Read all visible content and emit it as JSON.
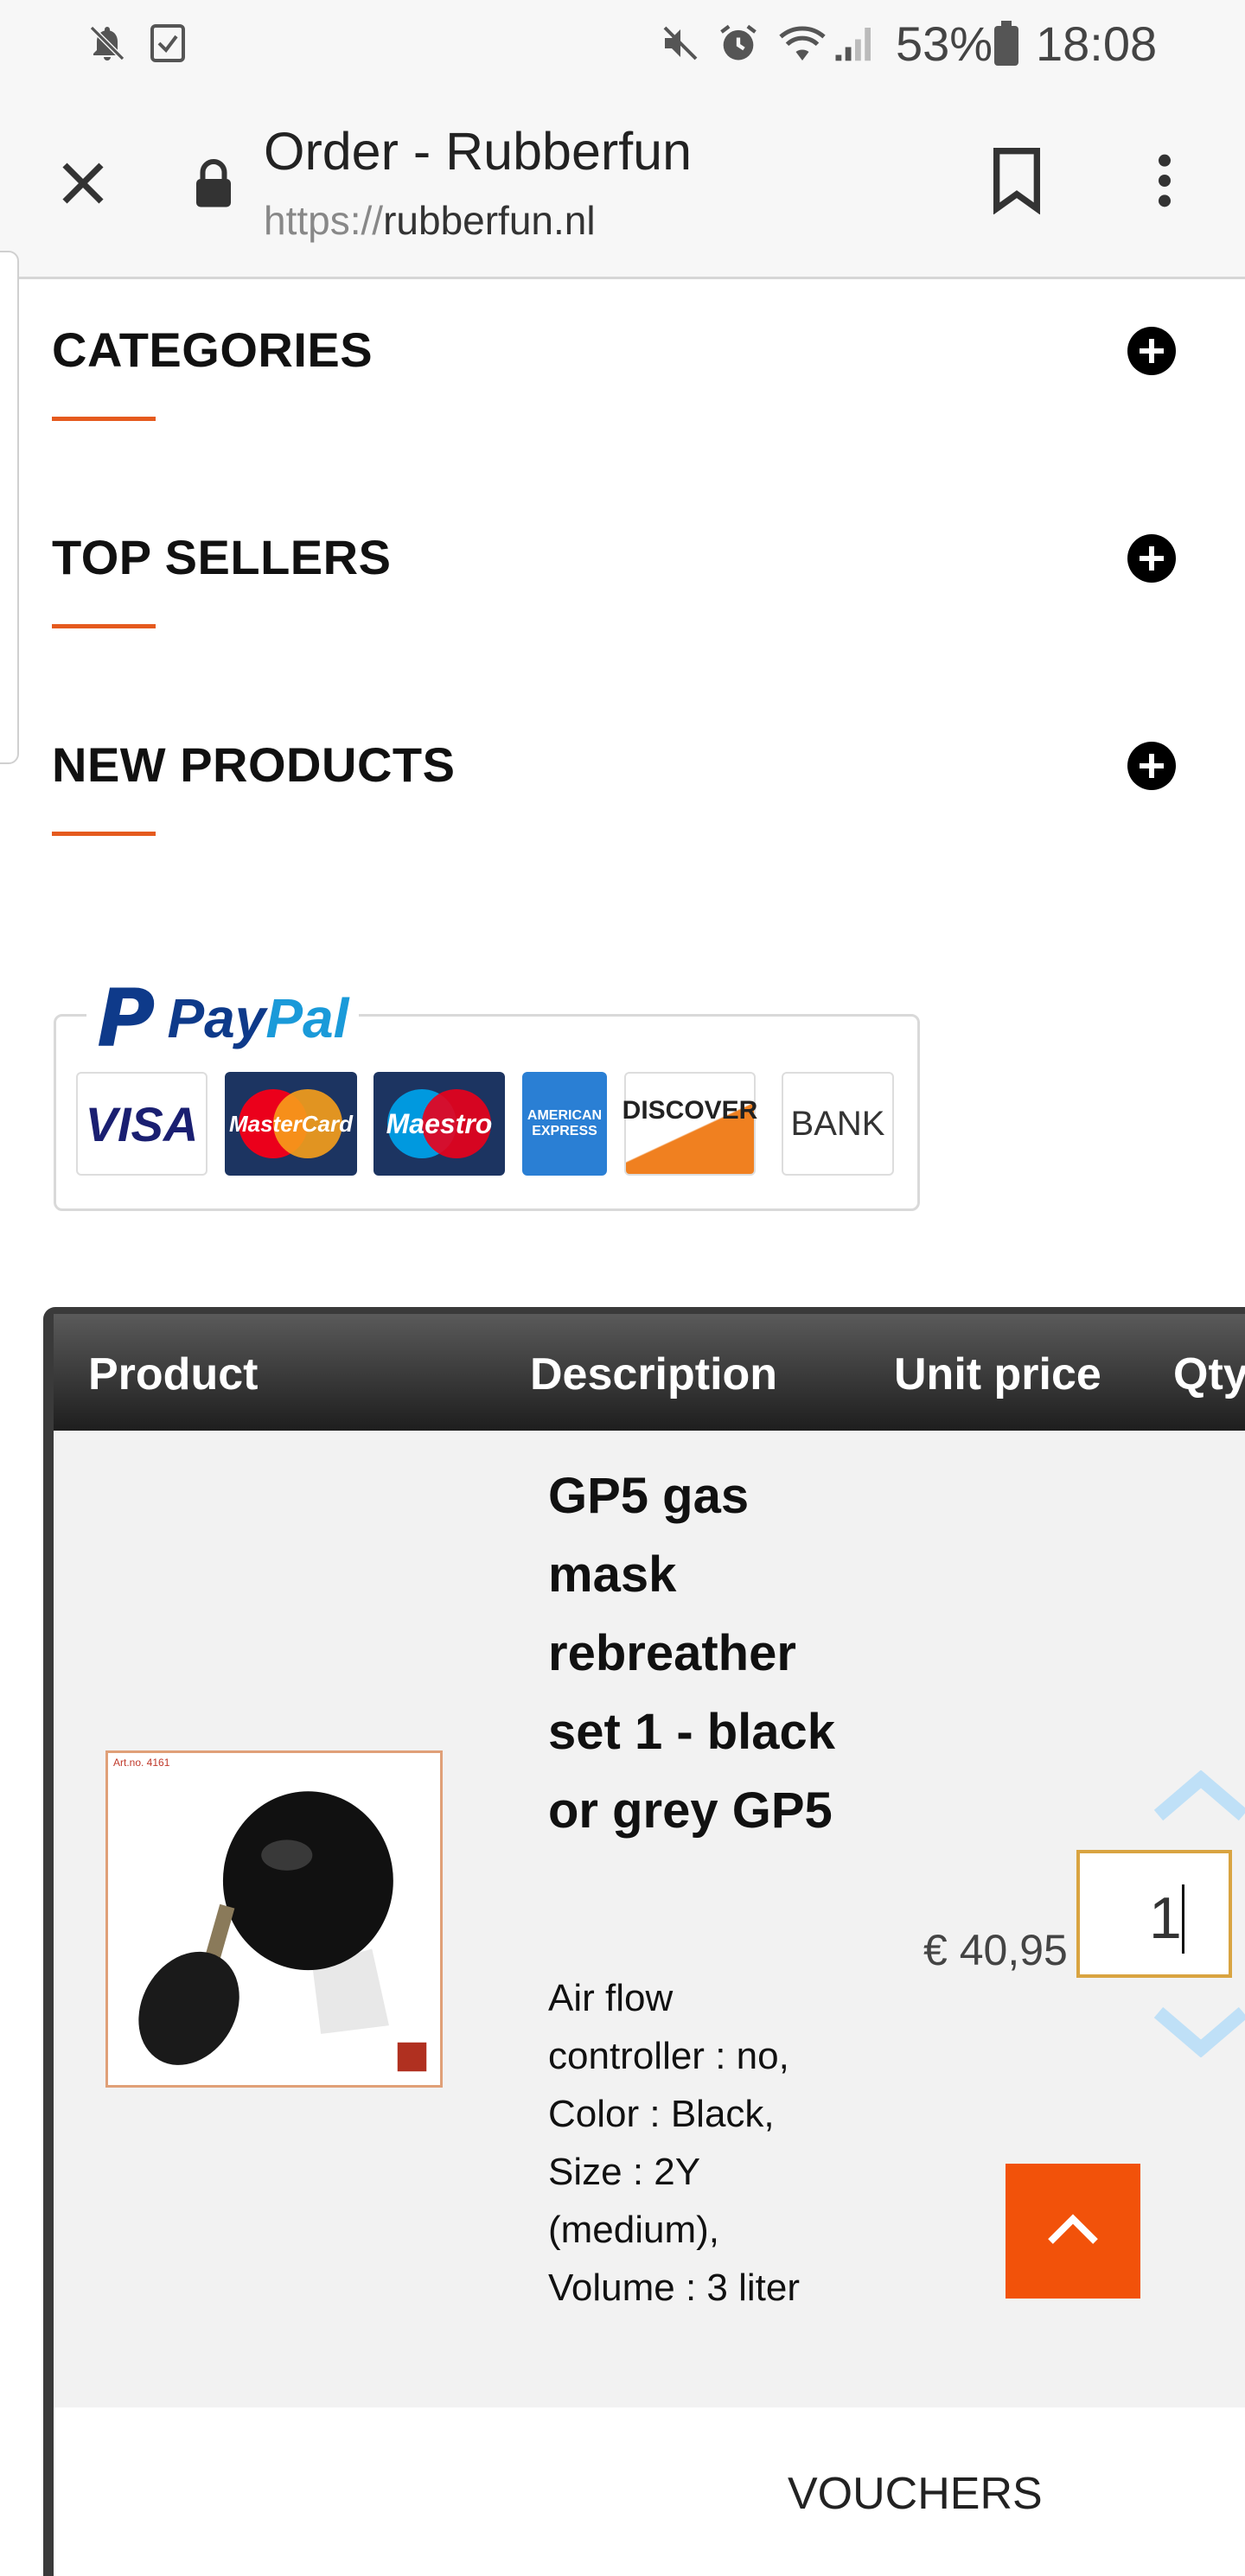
{
  "status_bar": {
    "battery_percent": "53%",
    "time": "18:08",
    "icons": [
      "notifications-off-icon",
      "task-icon",
      "mute-icon",
      "alarm-icon",
      "wifi-icon",
      "signal-icon",
      "battery-icon"
    ]
  },
  "browser": {
    "page_title": "Order - Rubberfun",
    "url_scheme": "https://",
    "url_host": "rubberfun.nl",
    "icons": [
      "close-icon",
      "lock-icon",
      "bookmark-icon",
      "more-vert-icon"
    ]
  },
  "accordion": [
    {
      "label": "CATEGORIES"
    },
    {
      "label": "TOP SELLERS"
    },
    {
      "label": "NEW PRODUCTS"
    }
  ],
  "payment": {
    "paypal_pay": "Pay",
    "paypal_pal": "Pal",
    "methods": [
      "VISA",
      "MasterCard",
      "Maestro",
      "AMERICAN EXPRESS",
      "DISCOVER",
      "BANK"
    ]
  },
  "cart_table": {
    "headers": {
      "product": "Product",
      "description": "Description",
      "unit_price": "Unit price",
      "qty": "Qty"
    },
    "row": {
      "title": "GP5 gas mask rebreather set 1 - black or grey GP5",
      "attributes": "Air flow controller : no, Color : Black, Size : 2Y (medium), Volume : 3 liter",
      "thumb_art_no": "Art.no. 4161",
      "unit_price": "€ 40,95",
      "quantity": "1"
    },
    "vouchers_label": "VOUCHERS"
  },
  "colors": {
    "accent": "#e55a1e",
    "scroll_top_button": "#f2520a",
    "qty_border": "#d9a441",
    "paypal_dark": "#0e3a8a",
    "paypal_light": "#1a9ad9"
  }
}
